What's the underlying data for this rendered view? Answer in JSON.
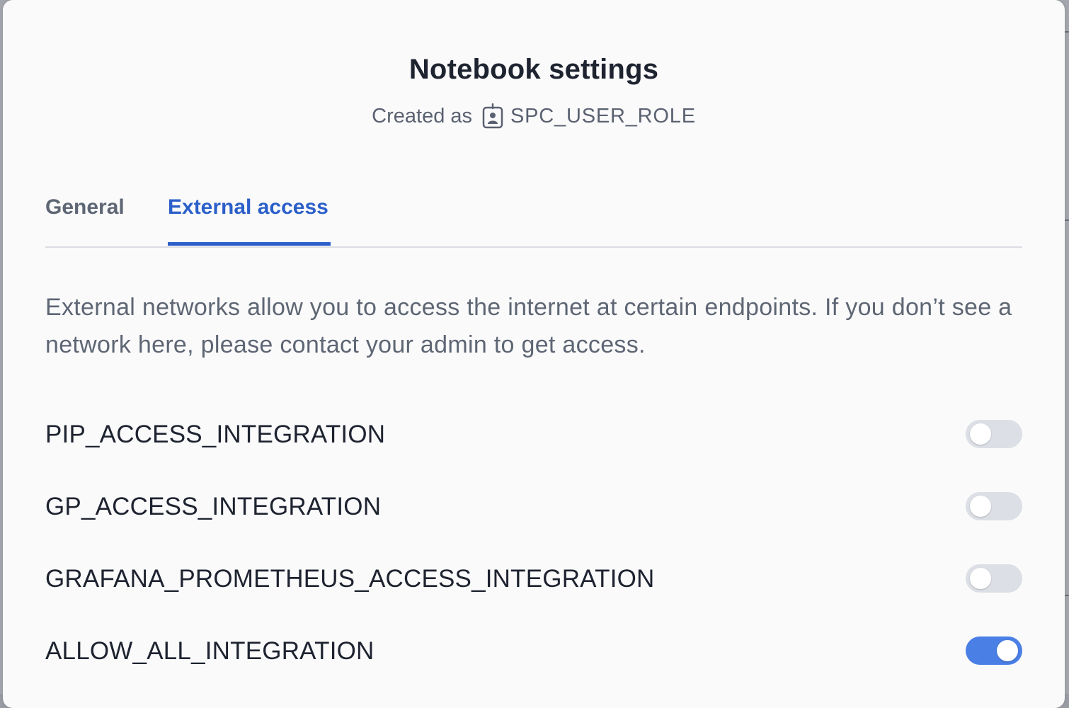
{
  "dialog": {
    "title": "Notebook settings",
    "subtitle_prefix": "Created as",
    "role_icon": "id-badge-icon",
    "role_name": "SPC_USER_ROLE"
  },
  "tabs": [
    {
      "label": "General",
      "active": false
    },
    {
      "label": "External access",
      "active": true
    }
  ],
  "description": "External networks allow you to access the internet at certain endpoints. If you don’t see a network here, please contact your admin to get access.",
  "integrations": [
    {
      "name": "PIP_ACCESS_INTEGRATION",
      "enabled": false
    },
    {
      "name": "GP_ACCESS_INTEGRATION",
      "enabled": false
    },
    {
      "name": "GRAFANA_PROMETHEUS_ACCESS_INTEGRATION",
      "enabled": false
    },
    {
      "name": "ALLOW_ALL_INTEGRATION",
      "enabled": true
    }
  ],
  "colors": {
    "accent": "#2b5fc9",
    "toggle_on": "#4a7fe6",
    "toggle_off": "#dcdfe5"
  }
}
